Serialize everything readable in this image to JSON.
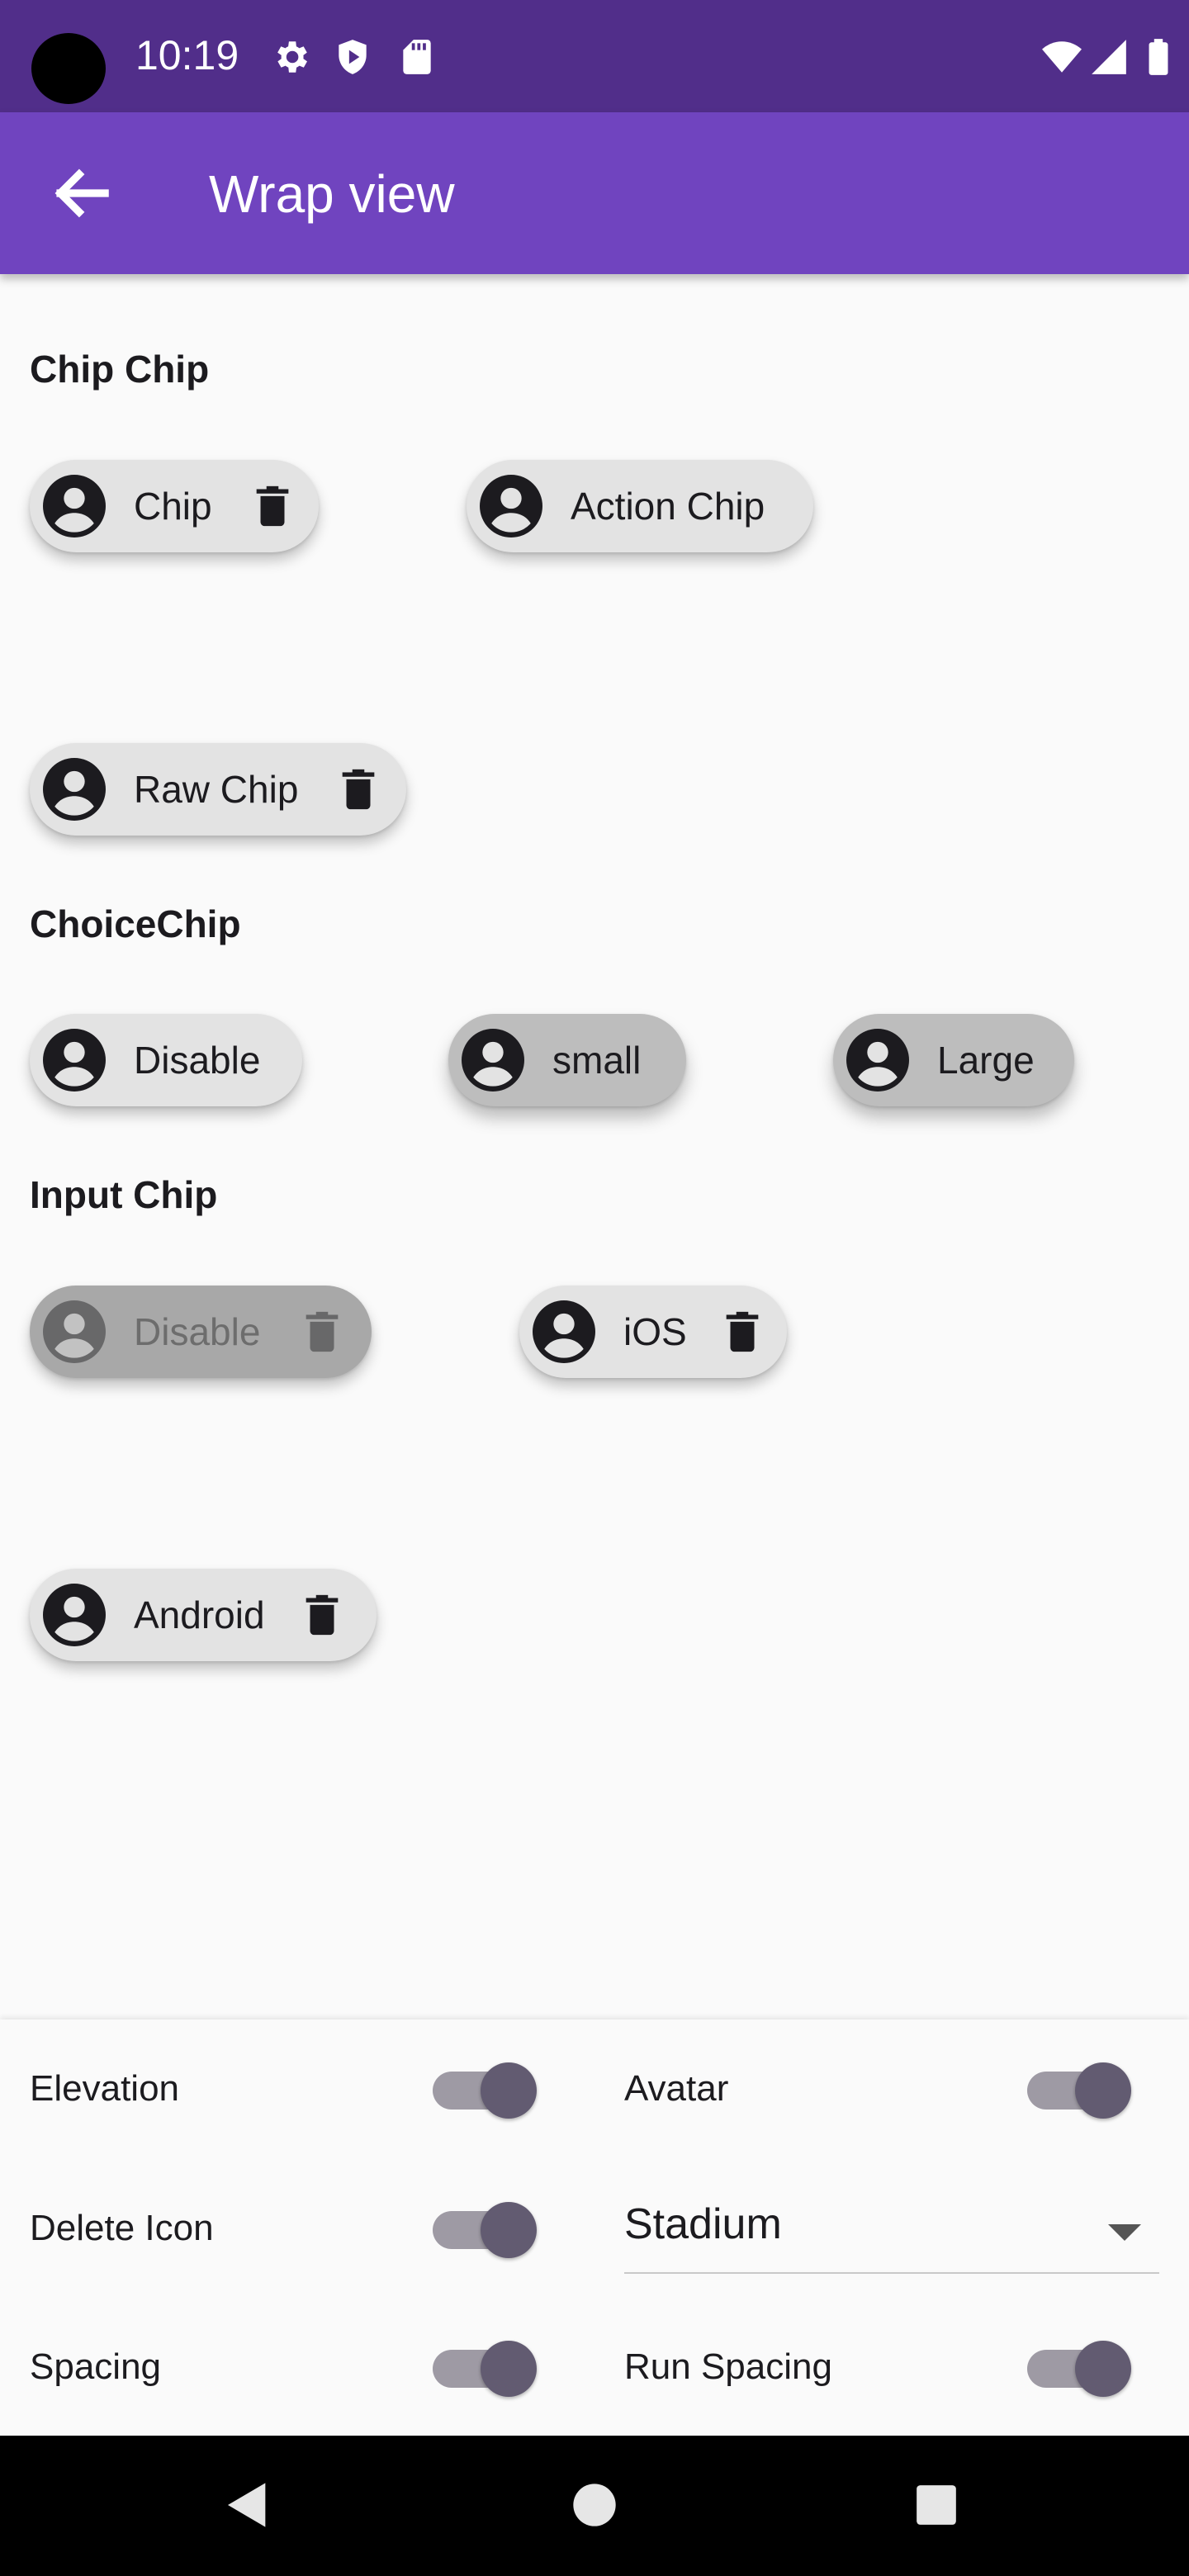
{
  "status_bar": {
    "time": "10:19",
    "icons": [
      "gear-icon",
      "shield-icon",
      "sd-card-icon",
      "wifi-icon",
      "signal-icon",
      "battery-icon"
    ]
  },
  "app_bar": {
    "title": "Wrap view",
    "back_icon": "arrow-left-icon"
  },
  "sections": {
    "chip": {
      "title": "Chip Chip",
      "chips": [
        {
          "label": "Chip",
          "has_delete": true
        },
        {
          "label": "Action Chip",
          "has_delete": false
        },
        {
          "label": "Raw Chip",
          "has_delete": true
        }
      ]
    },
    "choice": {
      "title": "ChoiceChip",
      "chips": [
        {
          "label": "Disable",
          "selected": false
        },
        {
          "label": "small",
          "selected": true
        },
        {
          "label": "Large",
          "selected": true
        }
      ]
    },
    "input": {
      "title": "Input Chip",
      "chips": [
        {
          "label": "Disable",
          "disabled": true
        },
        {
          "label": "iOS",
          "disabled": false
        },
        {
          "label": "Android",
          "disabled": false
        }
      ]
    }
  },
  "options": {
    "elevation": {
      "label": "Elevation",
      "on": true
    },
    "avatar": {
      "label": "Avatar",
      "on": true
    },
    "delete_icon": {
      "label": "Delete Icon",
      "on": true
    },
    "shape": {
      "value": "Stadium"
    },
    "spacing": {
      "label": "Spacing",
      "on": true
    },
    "run_spacing": {
      "label": "Run Spacing",
      "on": true
    }
  },
  "colors": {
    "status_bar": "#512e8a",
    "app_bar": "#7044bf",
    "chip_bg": "#e3e3e3",
    "chip_selected_bg": "#bdbdbd",
    "switch_thumb": "#625b71",
    "switch_track": "#9e9aa4"
  }
}
